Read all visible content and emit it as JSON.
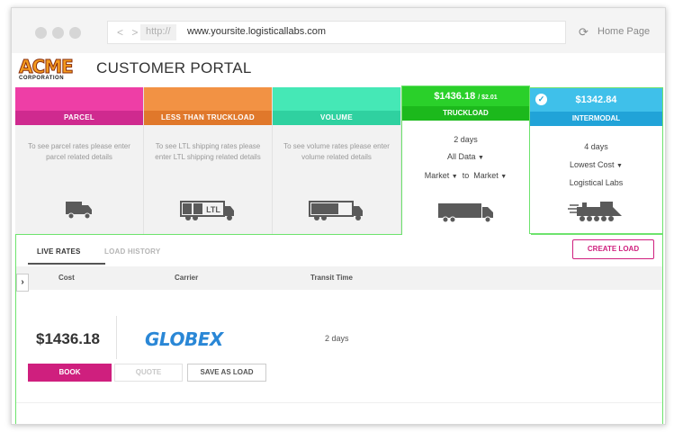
{
  "browser": {
    "nav_arrows": "< >",
    "protocol": "http://",
    "url": "www.yoursite.logisticallabs.com",
    "home_label": "Home Page"
  },
  "header": {
    "logo_main": "ACME",
    "logo_sub": "CORPORATION",
    "title": "CUSTOMER PORTAL"
  },
  "cards": {
    "parcel": {
      "label": "PARCEL",
      "desc": "To see parcel rates please enter parcel related details",
      "color_top": "#ee3ea6",
      "color_label": "#cf2a8f",
      "icon": "van-icon"
    },
    "ltl": {
      "label": "LESS THAN TRUCKLOAD",
      "desc": "To see LTL shipping rates please enter LTL shipping related details",
      "icon_text": "LTL",
      "color_top": "#f29244",
      "color_label": "#e0782b",
      "icon": "ltl-truck-icon"
    },
    "volume": {
      "label": "VOLUME",
      "desc": "To see volume rates please enter volume related details",
      "color_top": "#45e8b6",
      "color_label": "#2fd1a0",
      "icon": "volume-truck-icon"
    },
    "truckload": {
      "price": "$1436.18",
      "price_sub": "/ $2.01",
      "label": "TRUCKLOAD",
      "transit": "2 days",
      "data_filter": "All Data",
      "market_from": "Market",
      "to": "to",
      "market_to": "Market",
      "icon": "truck-icon"
    },
    "intermodal": {
      "price": "$1342.84",
      "label": "INTERMODAL",
      "transit": "4 days",
      "sort": "Lowest Cost",
      "provider": "Logistical Labs",
      "icon": "train-icon"
    }
  },
  "tabs": {
    "live_rates": "LIVE RATES",
    "load_history": "LOAD HISTORY",
    "create_load": "CREATE LOAD"
  },
  "table": {
    "headers": {
      "cost": "Cost",
      "carrier": "Carrier",
      "transit": "Transit Time"
    },
    "row": {
      "cost": "$1436.18",
      "carrier": "GLOBEX",
      "transit": "2 days"
    }
  },
  "actions": {
    "book": "BOOK",
    "quote": "QUOTE",
    "save": "SAVE AS LOAD"
  }
}
